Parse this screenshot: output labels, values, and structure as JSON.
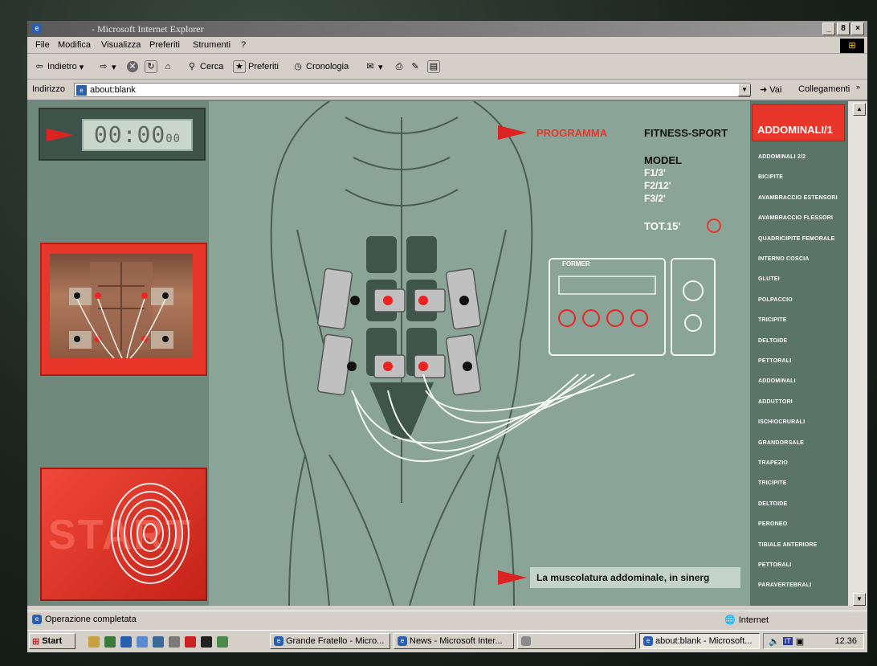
{
  "window": {
    "title": "- Microsoft Internet Explorer",
    "controls": {
      "minimize": "_",
      "maximize": "8",
      "close": "×"
    }
  },
  "menubar": [
    "File",
    "Modifica",
    "Visualizza",
    "Preferiti",
    "Strumenti",
    "?"
  ],
  "toolbar": {
    "back": "Indietro",
    "search": "Cerca",
    "favorites": "Preferiti",
    "history": "Cronologia"
  },
  "address": {
    "label": "Indirizzo",
    "value": "about:blank",
    "go": "Vai",
    "links": "Collegamenti"
  },
  "app": {
    "timer": {
      "main": "00:00",
      "fraction": "00"
    },
    "start_label": "START",
    "program_label": "PROGRAMMA",
    "program_name": "FITNESS-SPORT",
    "model_label": "MODEL",
    "model_lines": [
      "F1/3'",
      "F2/12'",
      "F3/2'"
    ],
    "total": "TOT.15'",
    "device_brand": "FORMER",
    "caption": "La muscolatura addominale, in sinerg",
    "active_program": "ADDOMINALI/1",
    "programs": [
      "ADDOMINALI 2/2",
      "BICIPITE",
      "AVAMBRACCIO ESTENSORI",
      "AVAMBRACCIO FLESSORI",
      "QUADRICIPITE FEMORALE",
      "INTERNO COSCIA",
      "GLUTEI",
      "POLPACCIO",
      "TRICIPITE",
      "DELTOIDE",
      "PETTORALI",
      "ADDOMINALI",
      "ADDUTTORI",
      "ISCHIOCRURALI",
      "GRANDORSALE",
      "TRAPEZIO",
      "TRICIPITE",
      "DELTOIDE",
      "PERONEO",
      "TIBIALE ANTERIORE",
      "PETTORALI",
      "PARAVERTEBRALI"
    ]
  },
  "statusbar": {
    "status": "Operazione completata",
    "zone": "Internet"
  },
  "taskbar": {
    "start": "Start",
    "tasks": [
      "Grande Fratello - Micro...",
      "News - Microsoft Inter...",
      "",
      "about:blank - Microsoft..."
    ],
    "clock": "12.36"
  },
  "colors": {
    "accent_red": "#e8362a",
    "panel_green": "#6f8a7d",
    "content_green": "#8aa498"
  }
}
